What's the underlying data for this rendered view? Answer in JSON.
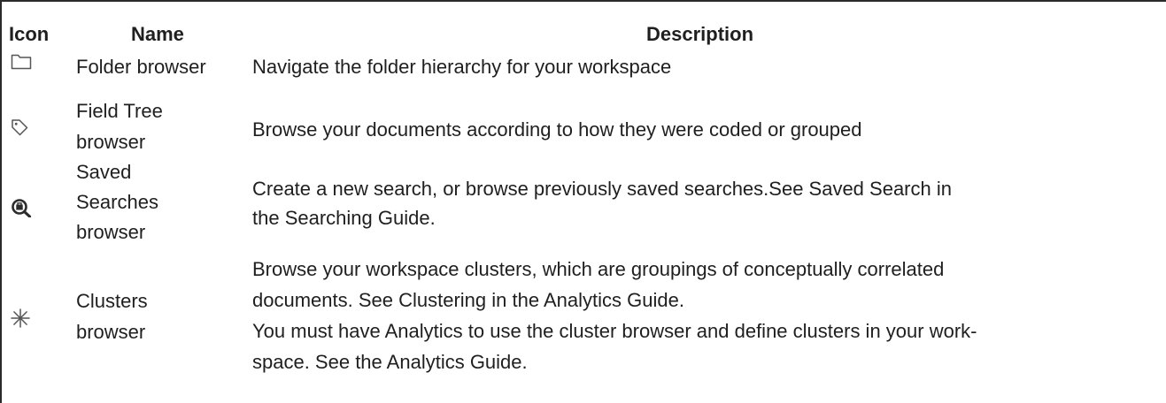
{
  "table": {
    "headers": {
      "icon": "Icon",
      "name": "Name",
      "description": "Description"
    },
    "rows": [
      {
        "icon": "folder-icon",
        "name": [
          "Folder browser"
        ],
        "description": [
          "Navigate the folder hierarchy for your workspace"
        ]
      },
      {
        "icon": "tag-icon",
        "name": [
          "Field Tree",
          "browser"
        ],
        "description": [
          "Browse your documents according to how they were coded or grouped"
        ]
      },
      {
        "icon": "saved-search-icon",
        "name": [
          "Saved",
          "Searches",
          "browser"
        ],
        "description": [
          "Create a new search, or browse previously saved searches.See Saved Search in",
          "the Searching Guide."
        ]
      },
      {
        "icon": "cluster-icon",
        "name": [
          "Clusters",
          "browser"
        ],
        "description": [
          "Browse your workspace clusters, which are groupings of conceptually correlated",
          "documents. See Clustering in the Analytics Guide.",
          "You must have Analytics to use the cluster browser and define clusters in your work-",
          "space. See the Analytics Guide."
        ]
      }
    ]
  }
}
